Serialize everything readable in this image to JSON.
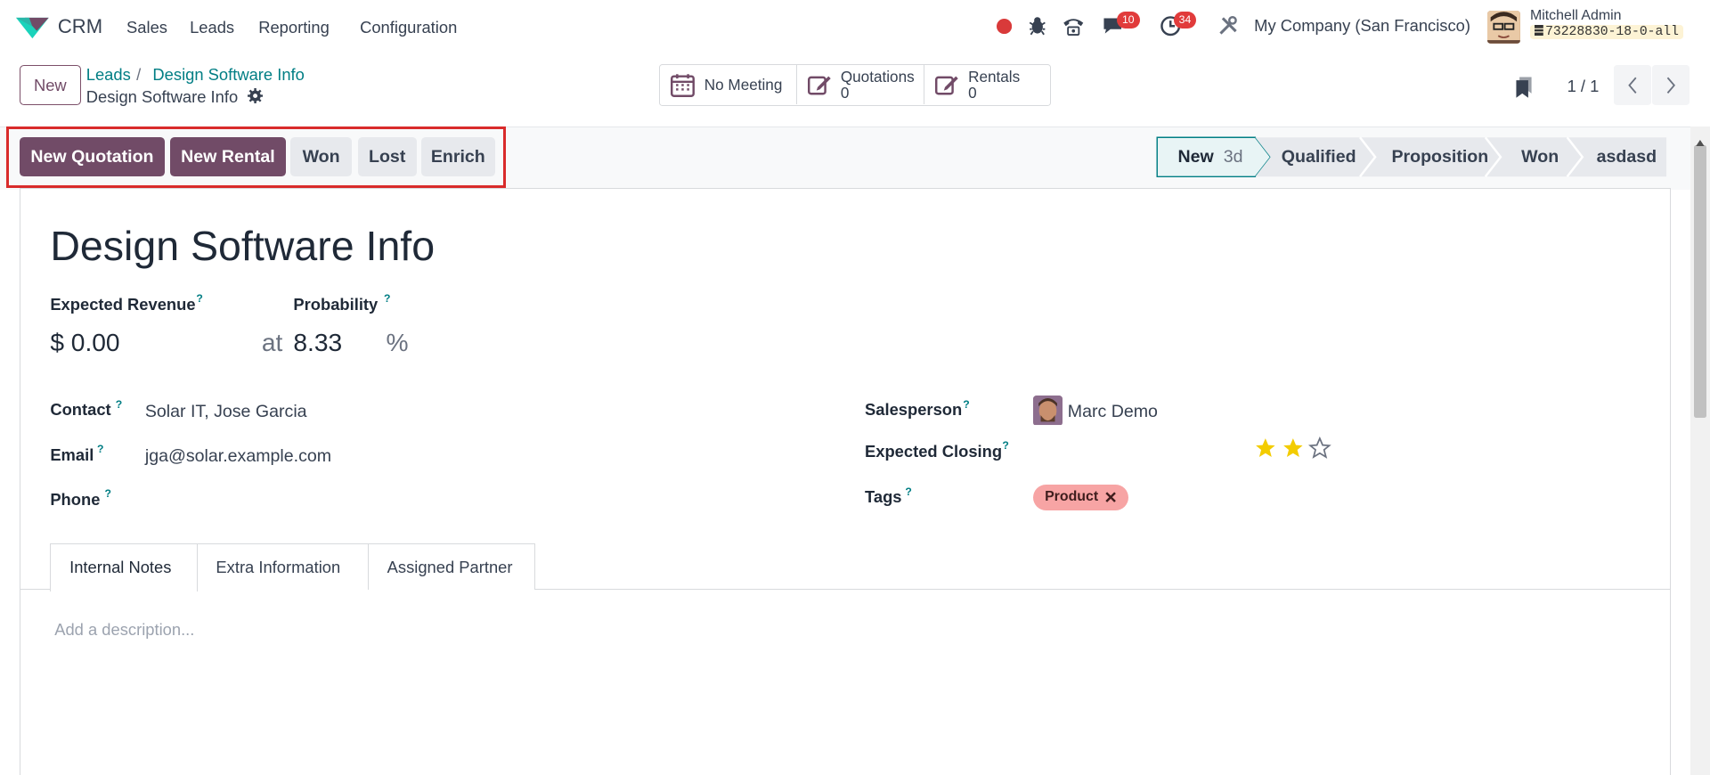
{
  "nav": {
    "app": "CRM",
    "menus": [
      "Sales",
      "Leads",
      "Reporting",
      "Configuration"
    ],
    "messages_count": "10",
    "activities_count": "34",
    "company": "My Company (San Francisco)",
    "user": "Mitchell Admin",
    "db": "73228830-18-0-all"
  },
  "control": {
    "new_label": "New",
    "breadcrumb_parent": "Leads",
    "breadcrumb_sep": "/",
    "breadcrumb_current": "Design Software Info",
    "record_name": "Design Software Info",
    "smart_buttons": {
      "meeting": "No Meeting",
      "quotations_label": "Quotations",
      "quotations_count": "0",
      "rentals_label": "Rentals",
      "rentals_count": "0"
    },
    "pager": "1 / 1"
  },
  "actions": {
    "new_quotation": "New Quotation",
    "new_rental": "New Rental",
    "won": "Won",
    "lost": "Lost",
    "enrich": "Enrich"
  },
  "stages": [
    {
      "label": "New",
      "duration": "3d",
      "active": true
    },
    {
      "label": "Qualified"
    },
    {
      "label": "Proposition"
    },
    {
      "label": "Won"
    },
    {
      "label": "asdasd"
    }
  ],
  "form": {
    "title": "Design Software Info",
    "expected_revenue_label": "Expected Revenue",
    "expected_revenue": "$ 0.00",
    "at": "at",
    "probability_label": "Probability",
    "probability": "8.33",
    "percent": "%",
    "contact_label": "Contact",
    "contact": "Solar IT, Jose Garcia",
    "email_label": "Email",
    "email": "jga@solar.example.com",
    "phone_label": "Phone",
    "salesperson_label": "Salesperson",
    "salesperson": "Marc Demo",
    "expected_closing_label": "Expected Closing",
    "priority_stars": 2,
    "priority_max": 3,
    "tags_label": "Tags",
    "tag": "Product",
    "help_mark": "?"
  },
  "tabs": [
    "Internal Notes",
    "Extra Information",
    "Assigned Partner"
  ],
  "notes_placeholder": "Add a description...",
  "colors": {
    "primary": "#714b67",
    "link": "#017e84",
    "tag": "#f7a4a4",
    "star": "#f3cc00",
    "badge": "#e13b3b"
  }
}
